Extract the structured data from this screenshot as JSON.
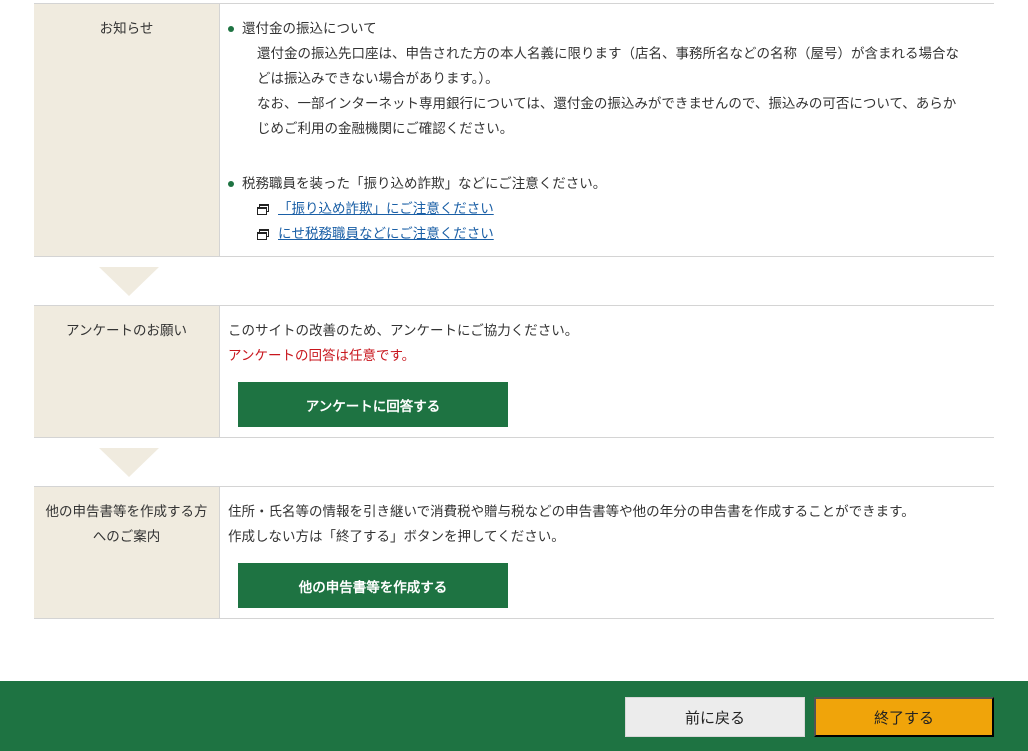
{
  "notice": {
    "label": "お知らせ",
    "item1": {
      "title": "還付金の振込について",
      "line1": "還付金の振込先口座は、申告された方の本人名義に限ります（店名、事務所名などの名称（屋号）が含まれる場合な",
      "line2": "どは振込みできない場合があります。）。",
      "line3": "なお、一部インターネット専用銀行については、還付金の振込みができませんので、振込みの可否について、あらか",
      "line4": "じめご利用の金融機関にご確認ください。"
    },
    "item2": {
      "title": "税務職員を装った「振り込め詐欺」などにご注意ください。",
      "links": [
        {
          "label": "「振り込め詐欺」にご注意ください"
        },
        {
          "label": "にせ税務職員などにご注意ください"
        }
      ]
    }
  },
  "survey": {
    "label": "アンケートのお願い",
    "text": "このサイトの改善のため、アンケートにご協力ください。",
    "note": "アンケートの回答は任意です。",
    "button": "アンケートに回答する"
  },
  "other": {
    "label_line1": "他の申告書等を作成する方",
    "label_line2": "へのご案内",
    "text1": "住所・氏名等の情報を引き継いで消費税や贈与税などの申告書等や他の年分の申告書を作成することができます。",
    "text2": "作成しない方は「終了する」ボタンを押してください。",
    "button": "他の申告書等を作成する"
  },
  "footer": {
    "back_label": "前に戻る",
    "end_label": "終了する"
  },
  "colors": {
    "green": "#1e7342",
    "beige": "#f0ebdf",
    "orange": "#f0a40a",
    "red": "#c8161d",
    "link": "#1a5fa6"
  }
}
